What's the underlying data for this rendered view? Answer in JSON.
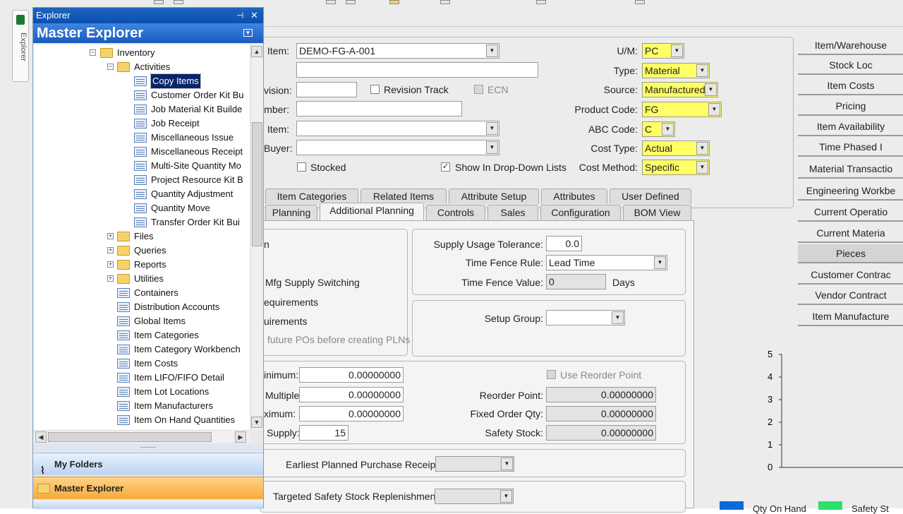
{
  "explorer": {
    "title": "Explorer",
    "pin_glyph": "⊣",
    "close_glyph": "✕",
    "header": "Master Explorer",
    "sidebar_tab_label": "Explorer",
    "tree": [
      {
        "label": "Inventory",
        "type": "folder",
        "level": 0,
        "expander": "−"
      },
      {
        "label": "Activities",
        "type": "folder",
        "level": 1,
        "expander": "−"
      },
      {
        "label": "Copy Items",
        "type": "form",
        "level": 2,
        "selected": true
      },
      {
        "label": "Customer Order Kit Bu",
        "type": "form",
        "level": 2
      },
      {
        "label": "Job Material Kit Builde",
        "type": "form",
        "level": 2
      },
      {
        "label": "Job Receipt",
        "type": "form",
        "level": 2
      },
      {
        "label": "Miscellaneous Issue",
        "type": "form",
        "level": 2
      },
      {
        "label": "Miscellaneous Receipt",
        "type": "form",
        "level": 2
      },
      {
        "label": "Multi-Site Quantity Mo",
        "type": "form",
        "level": 2
      },
      {
        "label": "Project Resource Kit B",
        "type": "form",
        "level": 2
      },
      {
        "label": "Quantity Adjustment",
        "type": "form",
        "level": 2
      },
      {
        "label": "Quantity Move",
        "type": "form",
        "level": 2
      },
      {
        "label": "Transfer Order Kit Bui",
        "type": "form",
        "level": 2
      },
      {
        "label": "Files",
        "type": "folder",
        "level": 1,
        "expander": "+"
      },
      {
        "label": "Queries",
        "type": "folder",
        "level": 1,
        "expander": "+"
      },
      {
        "label": "Reports",
        "type": "folder",
        "level": 1,
        "expander": "+"
      },
      {
        "label": "Utilities",
        "type": "folder",
        "level": 1,
        "expander": "+"
      },
      {
        "label": "Containers",
        "type": "form",
        "level": 1
      },
      {
        "label": "Distribution Accounts",
        "type": "form",
        "level": 1
      },
      {
        "label": "Global Items",
        "type": "form",
        "level": 1
      },
      {
        "label": "Item Categories",
        "type": "form",
        "level": 1
      },
      {
        "label": "Item Category Workbench",
        "type": "form",
        "level": 1
      },
      {
        "label": "Item Costs",
        "type": "form",
        "level": 1
      },
      {
        "label": "Item LIFO/FIFO Detail",
        "type": "form",
        "level": 1
      },
      {
        "label": "Item Lot Locations",
        "type": "form",
        "level": 1
      },
      {
        "label": "Item Manufacturers",
        "type": "form",
        "level": 1
      },
      {
        "label": "Item On Hand Quantities",
        "type": "form",
        "level": 1
      }
    ],
    "splitter_grip": "∙∙∙∙∙∙∙∙∙",
    "bottom_buttons": {
      "my_folders": "My Folders",
      "master_explorer": "Master Explorer"
    }
  },
  "header_fields": {
    "item": {
      "label": "Item:",
      "value": "DEMO-FG-A-001"
    },
    "description": {
      "value": ""
    },
    "revision": {
      "label": "vision:",
      "value": ""
    },
    "revision_track": {
      "label": "Revision Track",
      "checked": false
    },
    "ecn": {
      "label": "ECN",
      "checked": false
    },
    "number": {
      "label": "mber:",
      "value": ""
    },
    "item2": {
      "label": "Item:",
      "value": ""
    },
    "buyer": {
      "label": "Buyer:",
      "value": ""
    },
    "stocked": {
      "label": "Stocked",
      "checked": false
    },
    "show_dropdown": {
      "label": "Show In Drop-Down Lists",
      "checked": true
    },
    "um": {
      "label": "U/M:",
      "value": "PC"
    },
    "type": {
      "label": "Type:",
      "value": "Material"
    },
    "source": {
      "label": "Source:",
      "value": "Manufactured"
    },
    "product_code": {
      "label": "Product Code:",
      "value": "FG"
    },
    "abc_code": {
      "label": "ABC Code:",
      "value": "C"
    },
    "cost_type": {
      "label": "Cost Type:",
      "value": "Actual"
    },
    "cost_method": {
      "label": "Cost Method:",
      "value": "Specific"
    }
  },
  "tabs_row1": [
    "Item Categories",
    "Related Items",
    "Attribute Setup",
    "Attributes",
    "User Defined"
  ],
  "tabs_row2": [
    "Planning",
    "Additional Planning",
    "Controls",
    "Sales",
    "Configuration",
    "BOM View"
  ],
  "active_tab": "Additional Planning",
  "planning": {
    "left_group": {
      "top_fragment": "n",
      "mfg_supply_switching": "Mfg Supply Switching",
      "requirements1": "equirements",
      "requirements2": "uirements",
      "future_pos": "future POs before creating PLNs"
    },
    "supply_usage_tolerance": {
      "label": "Supply Usage Tolerance:",
      "value": "0.0"
    },
    "time_fence_rule": {
      "label": "Time Fence Rule:",
      "value": "Lead Time"
    },
    "time_fence_value": {
      "label": "Time Fence Value:",
      "value": "0",
      "unit": "Days"
    },
    "setup_group": {
      "label": "Setup Group:",
      "value": ""
    },
    "minimum": {
      "label": "inimum:",
      "value": "0.00000000"
    },
    "multiple": {
      "label": "Multiple:",
      "value": "0.00000000"
    },
    "maximum": {
      "label": "ximum:",
      "value": "0.00000000"
    },
    "supply": {
      "label": "Supply:",
      "value": "15"
    },
    "use_reorder_point": {
      "label": "Use Reorder Point",
      "checked": false
    },
    "reorder_point": {
      "label": "Reorder Point:",
      "value": "0.00000000"
    },
    "fixed_order_qty": {
      "label": "Fixed Order Qty:",
      "value": "0.00000000"
    },
    "safety_stock": {
      "label": "Safety Stock:",
      "value": "0.00000000"
    },
    "earliest_planned_purchase_receipt": {
      "label": "Earliest Planned Purchase Receipt:",
      "value": ""
    },
    "targeted_safety_stock": {
      "label": "Targeted Safety Stock Replenishment:",
      "value": ""
    }
  },
  "right_buttons": [
    "Item/Warehouse",
    "Stock Loc",
    "Item Costs",
    "Pricing",
    "Item Availability",
    "Time Phased I",
    "Material Transactio",
    "Engineering Workbe",
    "Current Operatio",
    "Current Materia",
    "Pieces",
    "Customer Contrac",
    "Vendor Contract",
    "Item Manufacture"
  ],
  "pressed_button": "Pieces",
  "chart_data": {
    "type": "bar",
    "y_ticks": [
      "5",
      "4",
      "3",
      "2",
      "1",
      "0"
    ],
    "ylim": [
      0,
      5
    ],
    "legend": [
      {
        "name": "Qty On Hand",
        "color": "#0a6ad8"
      },
      {
        "name": "Safety St",
        "color": "#2ee06a"
      }
    ],
    "legend_visible": [
      "Qty On Hand",
      "Safety St"
    ]
  }
}
